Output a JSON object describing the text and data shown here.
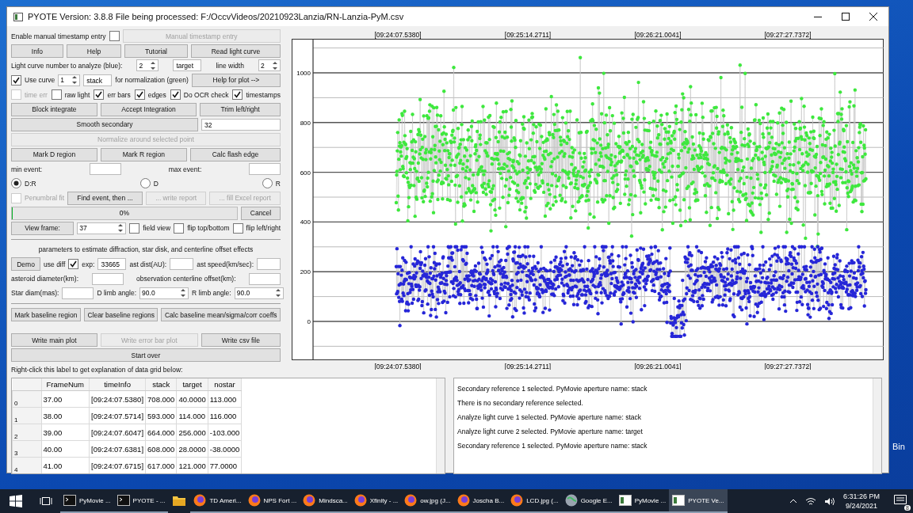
{
  "window": {
    "title": "PYOTE Version: 3.8.8  File being processed: F:/OccvVideos/20210923Lanzia/RN-Lanzia-PyM.csv"
  },
  "controls": [
    {
      "kind": "row",
      "items": [
        {
          "kind": "label",
          "text": "Enable manual timestamp entry"
        },
        {
          "kind": "check",
          "checked": false,
          "disabled": false
        },
        {
          "kind": "button",
          "label": "Manual timestamp entry",
          "disabled": true
        }
      ]
    },
    {
      "kind": "row",
      "items": [
        {
          "kind": "button",
          "label": "Info",
          "disabled": false
        },
        {
          "kind": "button",
          "label": "Help",
          "disabled": false
        },
        {
          "kind": "button",
          "label": "Tutorial",
          "disabled": false
        },
        {
          "kind": "button",
          "label": "Read light curve",
          "disabled": false
        }
      ]
    },
    {
      "kind": "row",
      "items": [
        {
          "kind": "label",
          "text": "Light curve number to analyze (blue):"
        },
        {
          "kind": "spin",
          "value": "2"
        },
        {
          "kind": "field",
          "value": "target"
        },
        {
          "kind": "label",
          "text": "line width"
        },
        {
          "kind": "spin",
          "value": "2"
        }
      ]
    },
    {
      "kind": "row",
      "items": [
        {
          "kind": "check",
          "label": "Use curve",
          "checked": true,
          "disabled": false
        },
        {
          "kind": "spin",
          "value": "1"
        },
        {
          "kind": "field",
          "value": "stack"
        },
        {
          "kind": "label",
          "text": "for normalization (green)"
        },
        {
          "kind": "button",
          "label": "Help for plot -->",
          "disabled": false
        }
      ]
    },
    {
      "kind": "row",
      "items": [
        {
          "kind": "check",
          "label": "time err",
          "checked": false,
          "disabled": true
        },
        {
          "kind": "check",
          "label": "raw light",
          "checked": false,
          "disabled": false
        },
        {
          "kind": "check",
          "label": "err bars",
          "checked": true,
          "disabled": false
        },
        {
          "kind": "check",
          "label": "edges",
          "checked": true,
          "disabled": false
        },
        {
          "kind": "check",
          "label": "Do OCR check",
          "checked": true,
          "disabled": false
        },
        {
          "kind": "check",
          "label": "timestamps",
          "checked": true,
          "disabled": false
        }
      ]
    },
    {
      "kind": "row",
      "items": [
        {
          "kind": "button",
          "label": "Block integrate",
          "disabled": false
        },
        {
          "kind": "button",
          "label": "Accept Integration",
          "disabled": false
        },
        {
          "kind": "button",
          "label": "Trim left/right",
          "disabled": false
        }
      ]
    },
    {
      "kind": "row",
      "items": [
        {
          "kind": "button",
          "label": "Smooth secondary",
          "disabled": false
        },
        {
          "kind": "field",
          "value": "32"
        }
      ]
    },
    {
      "kind": "row",
      "items": [
        {
          "kind": "button",
          "label": "Normalize around selected point",
          "disabled": true
        }
      ]
    },
    {
      "kind": "row",
      "items": [
        {
          "kind": "button",
          "label": "Mark D region",
          "disabled": false
        },
        {
          "kind": "button",
          "label": "Mark R region",
          "disabled": false
        },
        {
          "kind": "button",
          "label": "Calc flash edge",
          "disabled": false
        }
      ]
    },
    {
      "kind": "row",
      "items": [
        {
          "kind": "label",
          "text": "min event:"
        },
        {
          "kind": "field"
        },
        {
          "kind": "label",
          "text": "max event:"
        },
        {
          "kind": "field"
        }
      ]
    },
    {
      "kind": "row",
      "items": [
        {
          "kind": "radio",
          "label": "D:R",
          "selected": true
        },
        {
          "kind": "radio",
          "label": "D",
          "selected": false
        },
        {
          "kind": "radio",
          "label": "R",
          "selected": false
        }
      ]
    },
    {
      "kind": "row",
      "items": [
        {
          "kind": "check",
          "label": "Penumbral fit",
          "checked": false,
          "disabled": true
        },
        {
          "kind": "button",
          "label": "Find event, then ...",
          "disabled": false
        },
        {
          "kind": "button",
          "label": "... write report",
          "disabled": true
        },
        {
          "kind": "button",
          "label": "... fill Excel report",
          "disabled": true
        }
      ]
    },
    {
      "kind": "row",
      "items": [
        {
          "kind": "progress",
          "text": "0%",
          "level": 0
        },
        {
          "kind": "button",
          "label": "Cancel",
          "disabled": false
        }
      ]
    },
    {
      "kind": "row",
      "items": [
        {
          "kind": "button",
          "label": "View frame:",
          "disabled": false
        },
        {
          "kind": "spin",
          "value": "37"
        },
        {
          "kind": "check",
          "label": "field view",
          "checked": false,
          "disabled": false
        },
        {
          "kind": "check",
          "label": "flip top/bottom",
          "checked": false,
          "disabled": false
        },
        {
          "kind": "check",
          "label": "flip left/right",
          "checked": false,
          "disabled": false
        }
      ]
    },
    {
      "kind": "separator"
    },
    {
      "kind": "row",
      "items": [
        {
          "kind": "label",
          "text": "parameters to estimate diffraction, star disk, and centerline offset effects"
        }
      ]
    },
    {
      "kind": "row",
      "items": [
        {
          "kind": "button",
          "label": "Demo",
          "disabled": false
        },
        {
          "kind": "label",
          "text": "use diff"
        },
        {
          "kind": "check",
          "checked": true,
          "disabled": false
        },
        {
          "kind": "label",
          "text": "exp:"
        },
        {
          "kind": "field",
          "value": "33665"
        },
        {
          "kind": "label",
          "text": "ast dist(AU):"
        },
        {
          "kind": "field"
        },
        {
          "kind": "label",
          "text": "ast speed(km/sec):"
        },
        {
          "kind": "field"
        }
      ]
    },
    {
      "kind": "row",
      "items": [
        {
          "kind": "label",
          "text": "asteroid diameter(km):"
        },
        {
          "kind": "field"
        },
        {
          "kind": "label",
          "text": "observation centerline offset(km):"
        },
        {
          "kind": "field"
        }
      ]
    },
    {
      "kind": "row",
      "items": [
        {
          "kind": "label",
          "text": "Star diam(mas):"
        },
        {
          "kind": "field"
        },
        {
          "kind": "label",
          "text": "D limb angle:"
        },
        {
          "kind": "spin",
          "value": "90.0"
        },
        {
          "kind": "label",
          "text": "R limb angle:"
        },
        {
          "kind": "spin",
          "value": "90.0"
        }
      ]
    },
    {
      "kind": "separator"
    },
    {
      "kind": "row",
      "items": [
        {
          "kind": "button",
          "label": "Mark baseline region",
          "disabled": false
        },
        {
          "kind": "button",
          "label": "Clear baseline regions",
          "disabled": false
        },
        {
          "kind": "button",
          "label": "Calc baseline mean/sigma/corr coeffs",
          "disabled": false
        }
      ]
    },
    {
      "kind": "row",
      "items": [
        {
          "kind": "button",
          "label": "Write main plot",
          "disabled": false
        },
        {
          "kind": "button",
          "label": "Write error bar plot",
          "disabled": true
        },
        {
          "kind": "button",
          "label": "Write csv file",
          "disabled": false
        }
      ]
    },
    {
      "kind": "row",
      "items": [
        {
          "kind": "button",
          "label": "Start over",
          "disabled": false
        }
      ]
    },
    {
      "kind": "row",
      "items": [
        {
          "kind": "label",
          "text": "Right-click this label to get explanation of data grid below:"
        }
      ]
    }
  ],
  "plot": {
    "yticks": [
      "1000",
      "800",
      "600",
      "400",
      "200",
      "0"
    ],
    "xticks_top": [
      "[09:24:07.5380]",
      "[09:25:14.2711]",
      "[09:26:21.0041]",
      "[09:27:27.7372]"
    ],
    "xticks_bottom": [
      "[09:24:07.5380]",
      "[09:25:14.2711]",
      "[09:26:21.0041]",
      "[09:27:27.7372]"
    ]
  },
  "table": {
    "columns": [
      "FrameNum",
      "timeInfo",
      "stack",
      "target",
      "nostar"
    ],
    "rows": [
      {
        "index": "0",
        "cells": [
          "37.00",
          "[09:24:07.5380]",
          "708.000",
          "40.0000",
          "113.000"
        ]
      },
      {
        "index": "1",
        "cells": [
          "38.00",
          "[09:24:07.5714]",
          "593.000",
          "114.000",
          "116.000"
        ]
      },
      {
        "index": "2",
        "cells": [
          "39.00",
          "[09:24:07.6047]",
          "664.000",
          "256.000",
          "-103.000"
        ]
      },
      {
        "index": "3",
        "cells": [
          "40.00",
          "[09:24:07.6381]",
          "608.000",
          "28.0000",
          "-38.0000"
        ]
      },
      {
        "index": "4",
        "cells": [
          "41.00",
          "[09:24:07.6715]",
          "617.000",
          "121.000",
          "77.0000"
        ]
      }
    ]
  },
  "log": [
    "Secondary reference 1 selected. PyMovie aperture name: stack",
    "There is no secondary reference selected.",
    "Analyze light curve 1 selected. PyMovie aperture name: stack",
    "Analyze light curve 2 selected. PyMovie aperture name: target",
    "Secondary reference 1 selected. PyMovie aperture name: stack"
  ],
  "desktop": {
    "icon_label": "Bin"
  },
  "taskbar": {
    "items": [
      {
        "kind": "terminal",
        "label": "PyMovie ...",
        "selected": false
      },
      {
        "kind": "terminal",
        "label": "PYOTE - ...",
        "selected": false
      },
      {
        "kind": "folder",
        "selected": false
      },
      {
        "kind": "browser",
        "label": "TD Ameri...",
        "selected": false
      },
      {
        "kind": "browser",
        "label": "NPS Fort ...",
        "selected": false
      },
      {
        "kind": "browser",
        "label": "Mindsca...",
        "selected": false
      },
      {
        "kind": "browser",
        "label": "Xfinity - ...",
        "selected": false
      },
      {
        "kind": "browser",
        "label": "ow.jpg (J...",
        "selected": false
      },
      {
        "kind": "browser",
        "label": "Joscha B...",
        "selected": false
      },
      {
        "kind": "browser",
        "label": "LCD.jpg (...",
        "selected": false
      },
      {
        "kind": "globe",
        "label": "Google E...",
        "selected": false
      },
      {
        "kind": "window",
        "label": "PyMovie ...",
        "selected": false
      },
      {
        "kind": "window",
        "label": "PYOTE Ve...",
        "selected": true
      }
    ],
    "time": "6:31:26 PM",
    "date": "9/24/2021",
    "notifications": "8"
  }
}
